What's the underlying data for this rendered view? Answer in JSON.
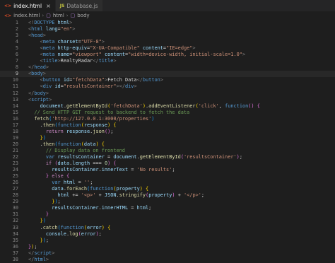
{
  "tabs": [
    {
      "label": "index.html",
      "icon": "html-file-icon",
      "icon_text": "<>",
      "active": true,
      "close": "×"
    },
    {
      "label": "Database.js",
      "icon": "js-file-icon",
      "icon_text": "JS",
      "active": false,
      "close": ""
    }
  ],
  "breadcrumb": {
    "file": "index.html",
    "items": [
      "html",
      "body"
    ],
    "separator": "›"
  },
  "active_line": 9,
  "lines": [
    {
      "n": 1,
      "t": [
        [
          "c-punct",
          "<!"
        ],
        [
          "c-doctype",
          "DOCTYPE"
        ],
        [
          "c-text",
          " "
        ],
        [
          "c-attr",
          "html"
        ],
        [
          "c-punct",
          ">"
        ]
      ]
    },
    {
      "n": 2,
      "t": [
        [
          "c-punct",
          "<"
        ],
        [
          "c-tag",
          "html"
        ],
        [
          "c-text",
          " "
        ],
        [
          "c-attr",
          "lang"
        ],
        [
          "c-text",
          "="
        ],
        [
          "c-str",
          "\"en\""
        ],
        [
          "c-punct",
          ">"
        ]
      ]
    },
    {
      "n": 3,
      "t": [
        [
          "c-punct",
          "<"
        ],
        [
          "c-tag",
          "head"
        ],
        [
          "c-punct",
          ">"
        ]
      ]
    },
    {
      "n": 4,
      "t": [
        [
          "c-text",
          "    "
        ],
        [
          "c-punct",
          "<"
        ],
        [
          "c-tag",
          "meta"
        ],
        [
          "c-text",
          " "
        ],
        [
          "c-attr",
          "charset"
        ],
        [
          "c-text",
          "="
        ],
        [
          "c-str",
          "\"UTF-8\""
        ],
        [
          "c-punct",
          ">"
        ]
      ]
    },
    {
      "n": 5,
      "t": [
        [
          "c-text",
          "    "
        ],
        [
          "c-punct",
          "<"
        ],
        [
          "c-tag",
          "meta"
        ],
        [
          "c-text",
          " "
        ],
        [
          "c-attr",
          "http-equiv"
        ],
        [
          "c-text",
          "="
        ],
        [
          "c-str",
          "\"X-UA-Compatible\""
        ],
        [
          "c-text",
          " "
        ],
        [
          "c-attr",
          "content"
        ],
        [
          "c-text",
          "="
        ],
        [
          "c-str",
          "\"IE=edge\""
        ],
        [
          "c-punct",
          ">"
        ]
      ]
    },
    {
      "n": 6,
      "t": [
        [
          "c-text",
          "    "
        ],
        [
          "c-punct",
          "<"
        ],
        [
          "c-tag",
          "meta"
        ],
        [
          "c-text",
          " "
        ],
        [
          "c-attr",
          "name"
        ],
        [
          "c-text",
          "="
        ],
        [
          "c-str",
          "\"viewport\""
        ],
        [
          "c-text",
          " "
        ],
        [
          "c-attr",
          "content"
        ],
        [
          "c-text",
          "="
        ],
        [
          "c-str",
          "\"width=device-width, initial-scale=1.0\""
        ],
        [
          "c-punct",
          ">"
        ]
      ]
    },
    {
      "n": 7,
      "t": [
        [
          "c-text",
          "    "
        ],
        [
          "c-punct",
          "<"
        ],
        [
          "c-tag",
          "title"
        ],
        [
          "c-punct",
          ">"
        ],
        [
          "c-text",
          "RealtyRadar"
        ],
        [
          "c-punct",
          "</"
        ],
        [
          "c-tag",
          "title"
        ],
        [
          "c-punct",
          ">"
        ]
      ]
    },
    {
      "n": 8,
      "t": [
        [
          "c-punct",
          "</"
        ],
        [
          "c-tag",
          "head"
        ],
        [
          "c-punct",
          ">"
        ]
      ]
    },
    {
      "n": 9,
      "t": [
        [
          "c-punct",
          "<"
        ],
        [
          "c-tag",
          "body"
        ],
        [
          "c-punct",
          ">"
        ]
      ]
    },
    {
      "n": 10,
      "t": [
        [
          "c-text",
          "    "
        ],
        [
          "c-punct",
          "<"
        ],
        [
          "c-tag",
          "button"
        ],
        [
          "c-text",
          " "
        ],
        [
          "c-attr",
          "id"
        ],
        [
          "c-text",
          "="
        ],
        [
          "c-str",
          "\"fetchData\""
        ],
        [
          "c-punct",
          ">"
        ],
        [
          "c-text",
          "Fetch Data"
        ],
        [
          "c-punct",
          "</"
        ],
        [
          "c-tag",
          "button"
        ],
        [
          "c-punct",
          ">"
        ]
      ]
    },
    {
      "n": 11,
      "t": [
        [
          "c-text",
          "    "
        ],
        [
          "c-punct",
          "<"
        ],
        [
          "c-tag",
          "div"
        ],
        [
          "c-text",
          " "
        ],
        [
          "c-attr",
          "id"
        ],
        [
          "c-text",
          "="
        ],
        [
          "c-str",
          "\"resultsContainer\""
        ],
        [
          "c-punct",
          "></"
        ],
        [
          "c-tag",
          "div"
        ],
        [
          "c-punct",
          ">"
        ]
      ]
    },
    {
      "n": 12,
      "t": [
        [
          "c-punct",
          "</"
        ],
        [
          "c-tag",
          "body"
        ],
        [
          "c-punct",
          ">"
        ]
      ]
    },
    {
      "n": 13,
      "t": [
        [
          "c-punct",
          "<"
        ],
        [
          "c-tag",
          "script"
        ],
        [
          "c-punct",
          ">"
        ]
      ]
    },
    {
      "n": 14,
      "t": [
        [
          "c-text",
          "    "
        ],
        [
          "c-var",
          "document"
        ],
        [
          "c-text",
          "."
        ],
        [
          "c-fn",
          "getElementById"
        ],
        [
          "c-brack1",
          "("
        ],
        [
          "c-str",
          "'fetchData'"
        ],
        [
          "c-brack1",
          ")"
        ],
        [
          "c-text",
          "."
        ],
        [
          "c-fn",
          "addEventListener"
        ],
        [
          "c-brack1",
          "("
        ],
        [
          "c-str",
          "'click'"
        ],
        [
          "c-text",
          ", "
        ],
        [
          "c-decl",
          "function"
        ],
        [
          "c-brack2",
          "()"
        ],
        [
          "c-text",
          " "
        ],
        [
          "c-brack2",
          "{"
        ]
      ]
    },
    {
      "n": 15,
      "t": [
        [
          "c-text",
          "  "
        ],
        [
          "c-comment",
          "// Send HTTP GET request to backend to fetch the data"
        ]
      ]
    },
    {
      "n": 16,
      "t": [
        [
          "c-text",
          "  "
        ],
        [
          "c-fn",
          "fetch"
        ],
        [
          "c-brack3",
          "("
        ],
        [
          "c-str",
          "'http://127.0.0.1:3000/properties'"
        ],
        [
          "c-brack3",
          ")"
        ]
      ]
    },
    {
      "n": 17,
      "t": [
        [
          "c-text",
          "    ."
        ],
        [
          "c-fn",
          "then"
        ],
        [
          "c-brack3",
          "("
        ],
        [
          "c-decl",
          "function"
        ],
        [
          "c-brack1",
          "("
        ],
        [
          "c-var",
          "response"
        ],
        [
          "c-brack1",
          ")"
        ],
        [
          "c-text",
          " "
        ],
        [
          "c-brack1",
          "{"
        ]
      ]
    },
    {
      "n": 18,
      "t": [
        [
          "c-text",
          "      "
        ],
        [
          "c-kw",
          "return"
        ],
        [
          "c-text",
          " "
        ],
        [
          "c-var",
          "response"
        ],
        [
          "c-text",
          "."
        ],
        [
          "c-fn",
          "json"
        ],
        [
          "c-brack2",
          "()"
        ],
        [
          "c-text",
          ";"
        ]
      ]
    },
    {
      "n": 19,
      "t": [
        [
          "c-text",
          "    "
        ],
        [
          "c-brack1",
          "}"
        ],
        [
          "c-brack3",
          ")"
        ]
      ]
    },
    {
      "n": 20,
      "t": [
        [
          "c-text",
          "    ."
        ],
        [
          "c-fn",
          "then"
        ],
        [
          "c-brack3",
          "("
        ],
        [
          "c-decl",
          "function"
        ],
        [
          "c-brack1",
          "("
        ],
        [
          "c-var",
          "data"
        ],
        [
          "c-brack1",
          ")"
        ],
        [
          "c-text",
          " "
        ],
        [
          "c-brack1",
          "{"
        ]
      ]
    },
    {
      "n": 21,
      "t": [
        [
          "c-text",
          "      "
        ],
        [
          "c-comment",
          "// Display data on frontend"
        ]
      ]
    },
    {
      "n": 22,
      "t": [
        [
          "c-text",
          "      "
        ],
        [
          "c-decl",
          "var"
        ],
        [
          "c-text",
          " "
        ],
        [
          "c-var",
          "resultsContainer"
        ],
        [
          "c-text",
          " = "
        ],
        [
          "c-var",
          "document"
        ],
        [
          "c-text",
          "."
        ],
        [
          "c-fn",
          "getElementById"
        ],
        [
          "c-brack2",
          "("
        ],
        [
          "c-str",
          "'resultsContainer'"
        ],
        [
          "c-brack2",
          ")"
        ],
        [
          "c-text",
          ";"
        ]
      ]
    },
    {
      "n": 23,
      "t": [
        [
          "c-text",
          "      "
        ],
        [
          "c-kw",
          "if"
        ],
        [
          "c-text",
          " "
        ],
        [
          "c-brack2",
          "("
        ],
        [
          "c-var",
          "data"
        ],
        [
          "c-text",
          "."
        ],
        [
          "c-var",
          "length"
        ],
        [
          "c-text",
          " === "
        ],
        [
          "c-num",
          "0"
        ],
        [
          "c-brack2",
          ")"
        ],
        [
          "c-text",
          " "
        ],
        [
          "c-brack2",
          "{"
        ]
      ]
    },
    {
      "n": 24,
      "t": [
        [
          "c-text",
          "        "
        ],
        [
          "c-var",
          "resultsContainer"
        ],
        [
          "c-text",
          "."
        ],
        [
          "c-var",
          "innerText"
        ],
        [
          "c-text",
          " = "
        ],
        [
          "c-str",
          "'No results'"
        ],
        [
          "c-text",
          ";"
        ]
      ]
    },
    {
      "n": 25,
      "t": [
        [
          "c-text",
          "      "
        ],
        [
          "c-brack2",
          "}"
        ],
        [
          "c-text",
          " "
        ],
        [
          "c-kw",
          "else"
        ],
        [
          "c-text",
          " "
        ],
        [
          "c-brack2",
          "{"
        ]
      ]
    },
    {
      "n": 26,
      "t": [
        [
          "c-text",
          "        "
        ],
        [
          "c-decl",
          "var"
        ],
        [
          "c-text",
          " "
        ],
        [
          "c-var",
          "html"
        ],
        [
          "c-text",
          " = "
        ],
        [
          "c-str",
          "''"
        ],
        [
          "c-text",
          ";"
        ]
      ]
    },
    {
      "n": 27,
      "t": [
        [
          "c-text",
          "        "
        ],
        [
          "c-var",
          "data"
        ],
        [
          "c-text",
          "."
        ],
        [
          "c-fn",
          "forEach"
        ],
        [
          "c-brack3",
          "("
        ],
        [
          "c-decl",
          "function"
        ],
        [
          "c-brack1",
          "("
        ],
        [
          "c-var",
          "property"
        ],
        [
          "c-brack1",
          ")"
        ],
        [
          "c-text",
          " "
        ],
        [
          "c-brack1",
          "{"
        ]
      ]
    },
    {
      "n": 28,
      "t": [
        [
          "c-text",
          "          "
        ],
        [
          "c-var",
          "html"
        ],
        [
          "c-text",
          " += "
        ],
        [
          "c-str",
          "'<p>'"
        ],
        [
          "c-text",
          " + "
        ],
        [
          "c-var",
          "JSON"
        ],
        [
          "c-text",
          "."
        ],
        [
          "c-fn",
          "stringify"
        ],
        [
          "c-brack2",
          "("
        ],
        [
          "c-var",
          "property"
        ],
        [
          "c-brack2",
          ")"
        ],
        [
          "c-text",
          " + "
        ],
        [
          "c-str",
          "'</p>'"
        ],
        [
          "c-text",
          ";"
        ]
      ]
    },
    {
      "n": 29,
      "t": [
        [
          "c-text",
          "        "
        ],
        [
          "c-brack1",
          "}"
        ],
        [
          "c-brack3",
          ")"
        ],
        [
          "c-text",
          ";"
        ]
      ]
    },
    {
      "n": 30,
      "t": [
        [
          "c-text",
          "        "
        ],
        [
          "c-var",
          "resultsContainer"
        ],
        [
          "c-text",
          "."
        ],
        [
          "c-var",
          "innerHTML"
        ],
        [
          "c-text",
          " = "
        ],
        [
          "c-var",
          "html"
        ],
        [
          "c-text",
          ";"
        ]
      ]
    },
    {
      "n": 31,
      "t": [
        [
          "c-text",
          "      "
        ],
        [
          "c-brack2",
          "}"
        ]
      ]
    },
    {
      "n": 32,
      "t": [
        [
          "c-text",
          "    "
        ],
        [
          "c-brack1",
          "}"
        ],
        [
          "c-brack3",
          ")"
        ]
      ]
    },
    {
      "n": 33,
      "t": [
        [
          "c-text",
          "    ."
        ],
        [
          "c-fn",
          "catch"
        ],
        [
          "c-brack3",
          "("
        ],
        [
          "c-decl",
          "function"
        ],
        [
          "c-brack1",
          "("
        ],
        [
          "c-var",
          "error"
        ],
        [
          "c-brack1",
          ")"
        ],
        [
          "c-text",
          " "
        ],
        [
          "c-brack1",
          "{"
        ]
      ]
    },
    {
      "n": 34,
      "t": [
        [
          "c-text",
          "      "
        ],
        [
          "c-var",
          "console"
        ],
        [
          "c-text",
          "."
        ],
        [
          "c-fn",
          "log"
        ],
        [
          "c-brack2",
          "("
        ],
        [
          "c-var",
          "error"
        ],
        [
          "c-brack2",
          ")"
        ],
        [
          "c-text",
          ";"
        ]
      ]
    },
    {
      "n": 35,
      "t": [
        [
          "c-text",
          "    "
        ],
        [
          "c-brack1",
          "}"
        ],
        [
          "c-brack3",
          ")"
        ],
        [
          "c-text",
          ";"
        ]
      ]
    },
    {
      "n": 36,
      "t": [
        [
          "c-brack2",
          "}"
        ],
        [
          "c-brack1",
          ")"
        ],
        [
          "c-text",
          ";"
        ]
      ]
    },
    {
      "n": 37,
      "t": [
        [
          "c-punct",
          "</"
        ],
        [
          "c-tag",
          "script"
        ],
        [
          "c-punct",
          ">"
        ]
      ]
    },
    {
      "n": 38,
      "t": [
        [
          "c-punct",
          "</"
        ],
        [
          "c-tag",
          "html"
        ],
        [
          "c-punct",
          ">"
        ]
      ]
    }
  ]
}
